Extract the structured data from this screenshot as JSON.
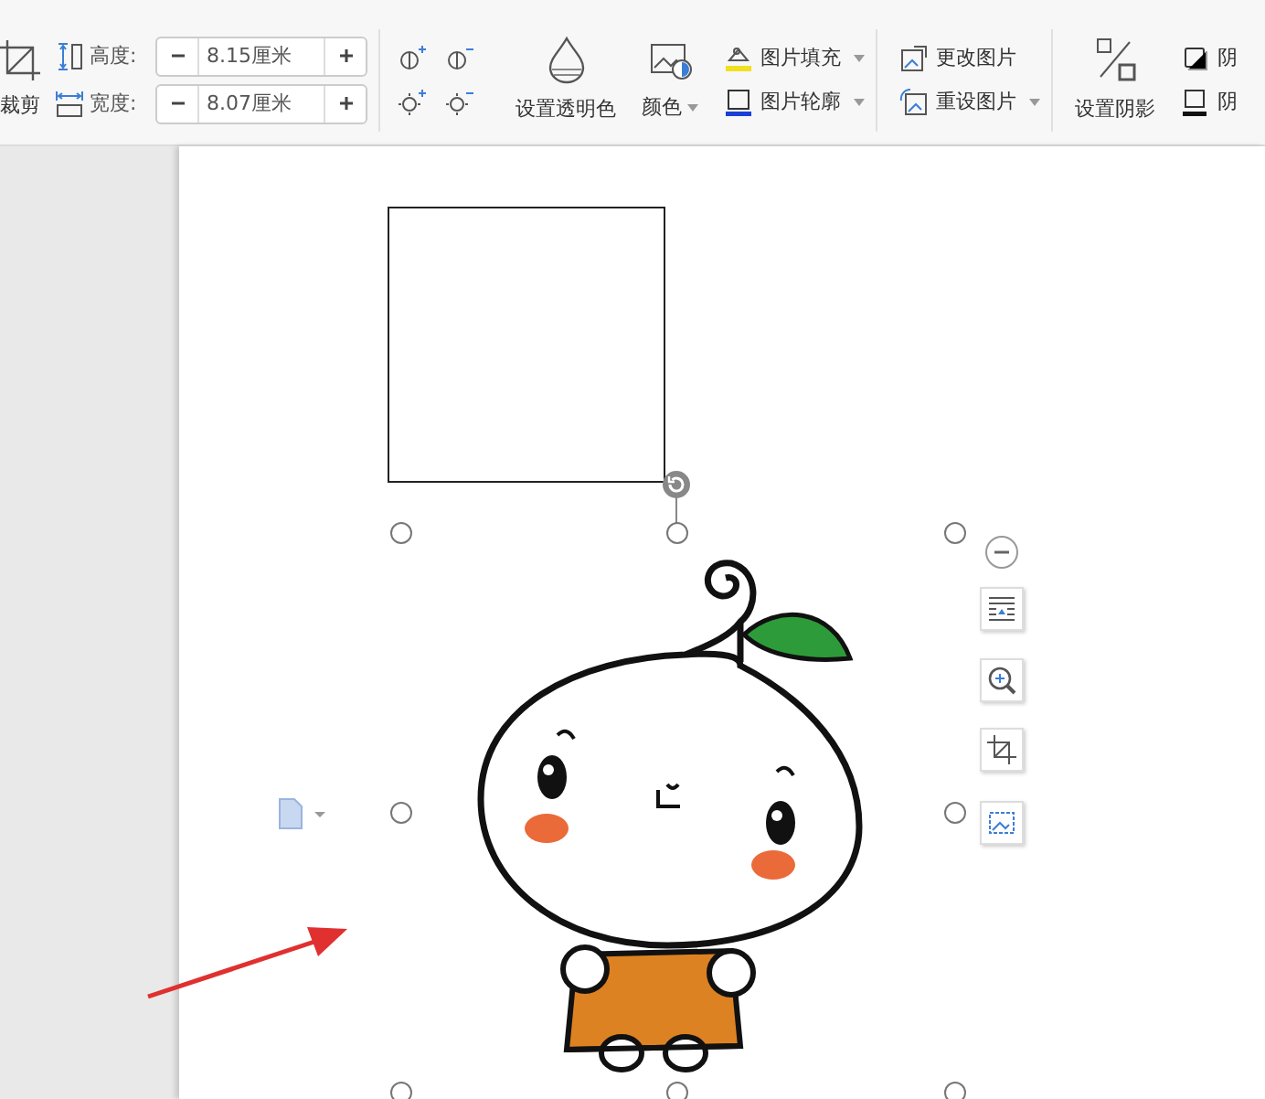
{
  "toolbar": {
    "crop_button": {
      "label": "裁剪"
    },
    "size_fields": [
      {
        "kind": "height",
        "label": "高度:",
        "value": "8.15厘米"
      },
      {
        "kind": "width",
        "label": "宽度:",
        "value": "8.07厘米"
      }
    ],
    "transparent_button": {
      "label": "设置透明色"
    },
    "color_button": {
      "label": "颜色"
    },
    "fill_buttons": [
      {
        "kind": "fill",
        "label": "图片填充"
      },
      {
        "kind": "outline",
        "label": "图片轮廓"
      }
    ],
    "picture_buttons": [
      {
        "kind": "change",
        "label": "更改图片"
      },
      {
        "kind": "reset",
        "label": "重设图片"
      }
    ],
    "shadow_button": {
      "label": "设置阴影"
    },
    "shadow_options": [
      {
        "kind": "box",
        "label": "阴"
      },
      {
        "kind": "underline",
        "label": "阴"
      }
    ]
  },
  "float_tools": [
    {
      "kind": "collapse"
    },
    {
      "kind": "wrap"
    },
    {
      "kind": "zoom"
    },
    {
      "kind": "crop"
    },
    {
      "kind": "fit"
    }
  ]
}
